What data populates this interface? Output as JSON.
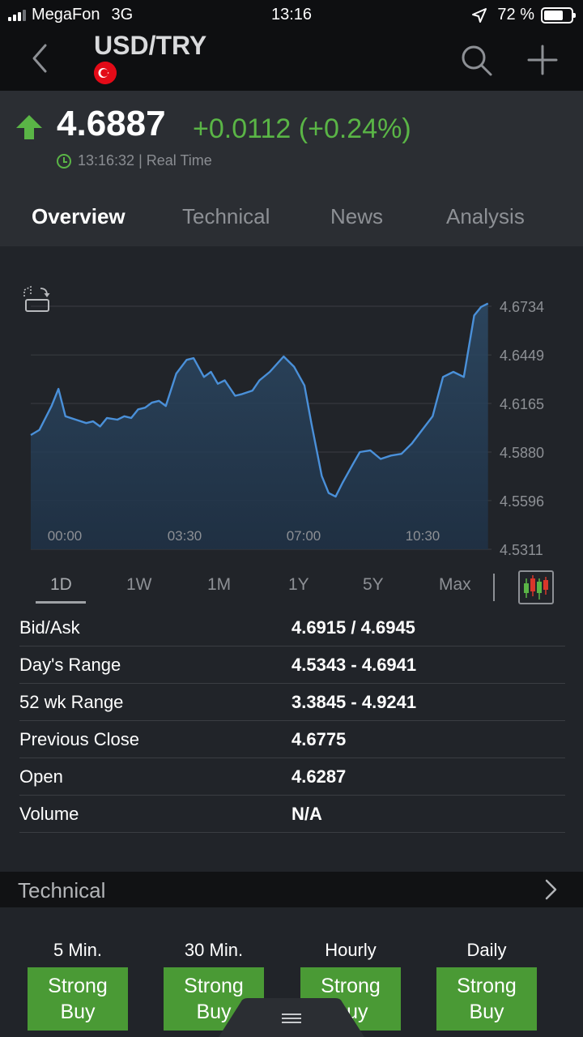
{
  "status_bar": {
    "carrier": "MegaFon",
    "network": "3G",
    "time": "13:16",
    "battery": "72 %"
  },
  "header": {
    "title": "USD/TRY",
    "flag_icon": "turkey-flag-icon"
  },
  "quote": {
    "price": "4.6887",
    "change": "+0.0112 (+0.24%)",
    "time": "13:16:32",
    "mode": "Real Time"
  },
  "tabs": [
    {
      "label": "Overview",
      "active": true
    },
    {
      "label": "Technical",
      "active": false
    },
    {
      "label": "News",
      "active": false
    },
    {
      "label": "Analysis",
      "active": false
    }
  ],
  "ranges": [
    {
      "label": "1D",
      "active": true
    },
    {
      "label": "1W"
    },
    {
      "label": "1M"
    },
    {
      "label": "1Y"
    },
    {
      "label": "5Y"
    },
    {
      "label": "Max"
    }
  ],
  "stats": [
    {
      "label": "Bid/Ask",
      "value": "4.6915 / 4.6945"
    },
    {
      "label": "Day's Range",
      "value": "4.5343 - 4.6941"
    },
    {
      "label": "52 wk Range",
      "value": "3.3845 - 4.9241"
    },
    {
      "label": "Previous Close",
      "value": "4.6775"
    },
    {
      "label": "Open",
      "value": "4.6287"
    },
    {
      "label": "Volume",
      "value": "N/A"
    }
  ],
  "technical": {
    "title": "Technical",
    "signals": [
      {
        "period": "5 Min.",
        "signal": "Strong Buy"
      },
      {
        "period": "30 Min.",
        "signal": "Strong Buy"
      },
      {
        "period": "Hourly",
        "signal": "Strong Buy"
      },
      {
        "period": "Daily",
        "signal": "Strong Buy"
      }
    ]
  },
  "colors": {
    "positive": "#5ab546",
    "line": "#4a90d9",
    "buy": "#4a9a35",
    "background": "#212429"
  },
  "chart_data": {
    "type": "area",
    "x_ticks": [
      "00:00",
      "03:30",
      "07:00",
      "10:30"
    ],
    "y_ticks": [
      4.6734,
      4.6449,
      4.6165,
      4.588,
      4.5596,
      4.5311
    ],
    "ylim": [
      4.5311,
      4.6734
    ],
    "xlim": [
      0,
      13.3
    ],
    "grid": true,
    "series": [
      {
        "x": [
          0,
          0.25,
          0.6,
          0.8,
          1.0,
          1.3,
          1.6,
          1.8,
          2.0,
          2.2,
          2.5,
          2.7,
          2.9,
          3.1,
          3.3,
          3.5,
          3.7,
          3.9,
          4.2,
          4.5,
          4.7,
          5.0,
          5.2,
          5.4,
          5.6,
          5.9,
          6.1,
          6.4,
          6.6,
          6.9,
          7.3,
          7.6,
          7.9,
          8.1,
          8.4,
          8.6,
          8.8,
          9.0,
          9.3,
          9.5,
          9.8,
          10.1,
          10.4,
          10.7,
          11.0,
          11.3,
          11.6,
          11.9,
          12.2,
          12.5,
          12.8,
          13.0,
          13.2
        ],
        "y": [
          4.598,
          4.601,
          4.615,
          4.625,
          4.609,
          4.607,
          4.605,
          4.606,
          4.603,
          4.608,
          4.607,
          4.609,
          4.608,
          4.613,
          4.614,
          4.617,
          4.618,
          4.615,
          4.634,
          4.642,
          4.643,
          4.632,
          4.635,
          4.628,
          4.63,
          4.621,
          4.622,
          4.624,
          4.63,
          4.635,
          4.644,
          4.638,
          4.627,
          4.605,
          4.574,
          4.564,
          4.562,
          4.57,
          4.581,
          4.588,
          4.589,
          4.584,
          4.586,
          4.587,
          4.593,
          4.601,
          4.609,
          4.632,
          4.635,
          4.632,
          4.668,
          4.673,
          4.675
        ]
      }
    ]
  }
}
